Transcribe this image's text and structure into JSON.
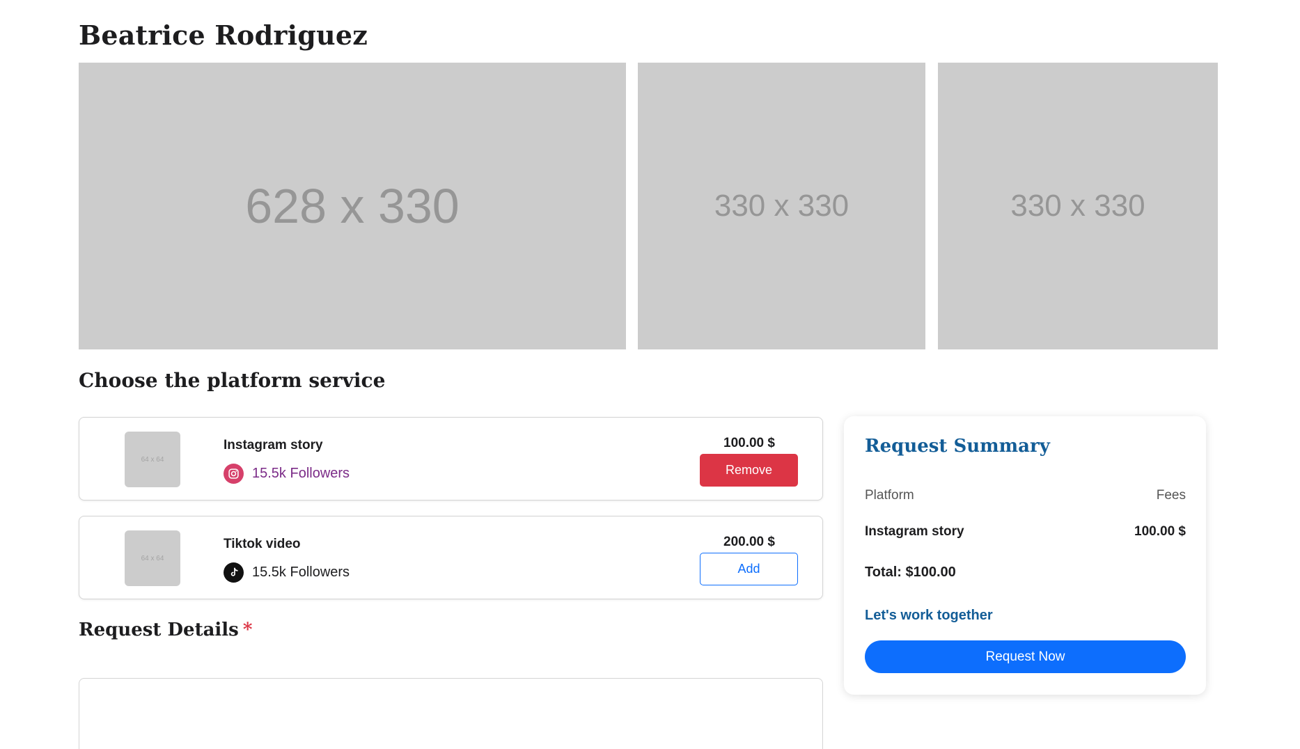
{
  "profile": {
    "name": "Beatrice Rodriguez"
  },
  "gallery": {
    "main_placeholder": "628 x 330",
    "side_placeholders": [
      "330 x 330",
      "330 x 330"
    ]
  },
  "services_section": {
    "title": "Choose the platform service",
    "items": [
      {
        "thumb_placeholder": "64 x 64",
        "name": "Instagram story",
        "platform_icon": "instagram-icon",
        "followers": "15.5k Followers",
        "price": "100.00 $",
        "action_label": "Remove",
        "action_type": "remove"
      },
      {
        "thumb_placeholder": "64 x 64",
        "name": "Tiktok video",
        "platform_icon": "tiktok-icon",
        "followers": "15.5k Followers",
        "price": "200.00 $",
        "action_label": "Add",
        "action_type": "add"
      }
    ]
  },
  "request_details": {
    "title": "Request Details",
    "required_marker": "*",
    "value": ""
  },
  "summary": {
    "title": "Request Summary",
    "header_platform": "Platform",
    "header_fees": "Fees",
    "items": [
      {
        "platform": "Instagram story",
        "fee": "100.00 $"
      }
    ],
    "total": "Total: $100.00",
    "cta_label": "Let's work together",
    "request_button": "Request Now"
  },
  "colors": {
    "accent_blue": "#0d6efd",
    "heading_blue": "#135d97",
    "danger_red": "#dc3545",
    "placeholder_gray": "#cccccc",
    "instagram_pink": "#d6406a",
    "followers_purple": "#7b2b87"
  }
}
